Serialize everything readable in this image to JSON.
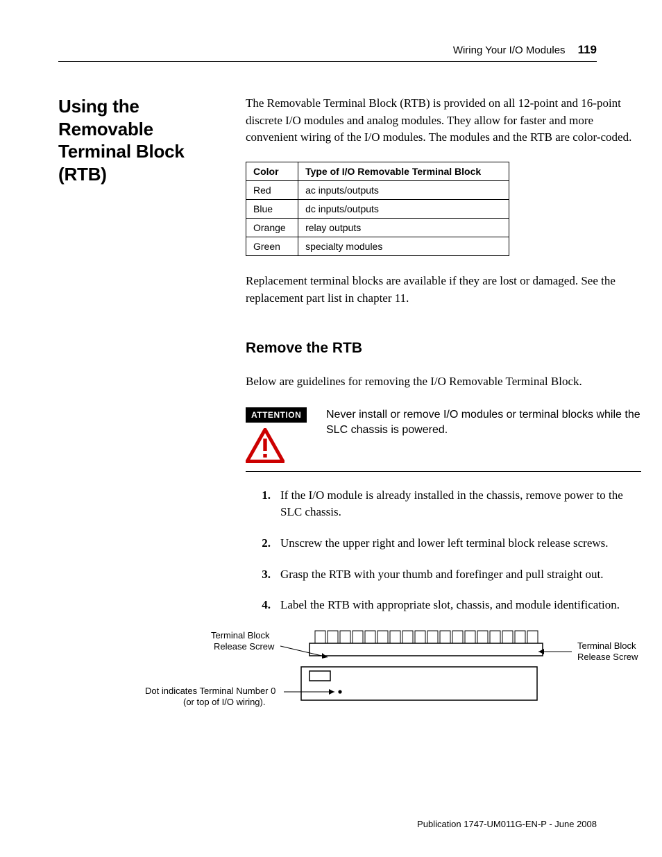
{
  "running_header": {
    "title": "Wiring Your I/O Modules",
    "page_number": "119"
  },
  "section": {
    "title": "Using the Removable Terminal Block (RTB)"
  },
  "intro": "The Removable Terminal Block (RTB) is provided on all 12-point and 16-point discrete I/O modules and analog modules. They allow for faster and more convenient wiring of the I/O modules. The modules and the RTB are color-coded.",
  "table": {
    "headers": {
      "col0": "Color",
      "col1": "Type of I/O Removable Terminal Block"
    },
    "rows": [
      {
        "color": "Red",
        "type": "ac inputs/outputs"
      },
      {
        "color": "Blue",
        "type": "dc inputs/outputs"
      },
      {
        "color": "Orange",
        "type": "relay outputs"
      },
      {
        "color": "Green",
        "type": "specialty modules"
      }
    ]
  },
  "after_table": "Replacement terminal blocks are available if they are lost or damaged. See the replacement part list in chapter 11.",
  "sub": {
    "title": "Remove the RTB",
    "intro": "Below are guidelines for removing the I/O Removable Terminal Block."
  },
  "attention": {
    "label": "ATTENTION",
    "text": "Never install or remove I/O modules or terminal blocks while the SLC chassis is powered."
  },
  "steps": [
    {
      "n": "1.",
      "t": "If the I/O module is already installed in the chassis, remove power to the SLC chassis."
    },
    {
      "n": "2.",
      "t": "Unscrew the upper right and lower left terminal block release screws."
    },
    {
      "n": "3.",
      "t": "Grasp the RTB with your thumb and forefinger and pull straight out."
    },
    {
      "n": "4.",
      "t": "Label the RTB with appropriate slot, chassis, and module identification."
    }
  ],
  "diagram": {
    "label_left_top": "Terminal Block Release Screw",
    "label_left_bottom": "Dot indicates Terminal Number 0 (or top of I/O wiring).",
    "label_right": "Terminal Block Release Screw"
  },
  "publication": "Publication 1747-UM011G-EN-P - June 2008"
}
